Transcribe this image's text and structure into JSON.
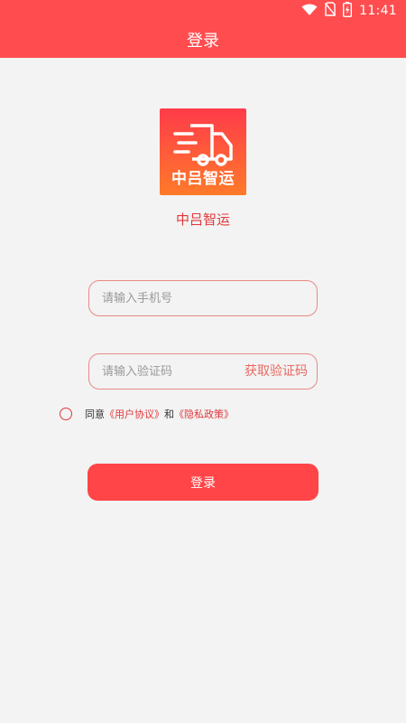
{
  "status_bar": {
    "time": "11:41",
    "icons": [
      "wifi-icon",
      "no-sim-icon",
      "battery-charging-icon"
    ]
  },
  "header": {
    "title": "登录"
  },
  "brand": {
    "logo_text": "中吕智运",
    "app_name": "中吕智运",
    "logo_icon": "delivery-truck-icon"
  },
  "form": {
    "phone_placeholder": "请输入手机号",
    "phone_value": "",
    "code_placeholder": "请输入验证码",
    "code_value": "",
    "get_code_label": "获取验证码"
  },
  "agreement": {
    "checked": false,
    "prefix": "同意",
    "user_agreement": "《用户协议》",
    "and": "和",
    "privacy_policy": "《隐私政策》"
  },
  "actions": {
    "login_label": "登录"
  },
  "colors": {
    "primary": "#ff4d4f",
    "accent_text": "#e0383b",
    "field_border": "#e88a85",
    "background": "#f3f3f3"
  }
}
